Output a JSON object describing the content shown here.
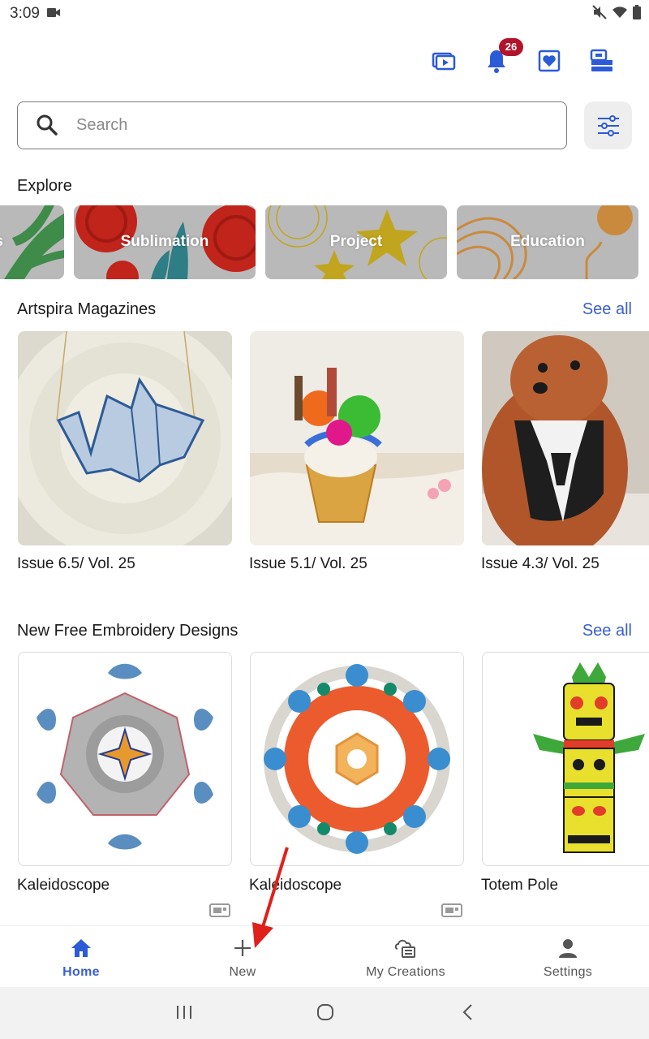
{
  "status_bar": {
    "time": "3:09"
  },
  "header": {
    "actions": [
      {
        "icon": "video-tutorial-icon"
      },
      {
        "icon": "bell-icon",
        "badge": "26"
      },
      {
        "icon": "favorites-heart-icon"
      },
      {
        "icon": "sewing-machine-icon"
      }
    ]
  },
  "search": {
    "placeholder": "Search",
    "value": ""
  },
  "explore": {
    "title": "Explore",
    "cards": [
      {
        "label": "Designs"
      },
      {
        "label": "Sublimation"
      },
      {
        "label": "Project"
      },
      {
        "label": "Education"
      }
    ]
  },
  "magazines": {
    "title": "Artspira Magazines",
    "see_all": "See all",
    "items": [
      {
        "caption": "Issue 6.5/ Vol. 25"
      },
      {
        "caption": "Issue 5.1/ Vol. 25"
      },
      {
        "caption": "Issue 4.3/ Vol. 25"
      }
    ]
  },
  "free_designs": {
    "title": "New Free Embroidery Designs",
    "see_all": "See all",
    "items": [
      {
        "caption": "Kaleidoscope"
      },
      {
        "caption": "Kaleidoscope"
      },
      {
        "caption": "Totem Pole"
      }
    ]
  },
  "bottom_nav": {
    "items": [
      {
        "label": "Home",
        "icon": "home-icon",
        "active": true
      },
      {
        "label": "New",
        "icon": "plus-icon",
        "active": false
      },
      {
        "label": "My Creations",
        "icon": "cloud-creations-icon",
        "active": false
      },
      {
        "label": "Settings",
        "icon": "person-icon",
        "active": false
      }
    ]
  },
  "colors": {
    "accent": "#3a5fcd",
    "badge": "#b3132a",
    "annotation_arrow": "#e0201b"
  }
}
